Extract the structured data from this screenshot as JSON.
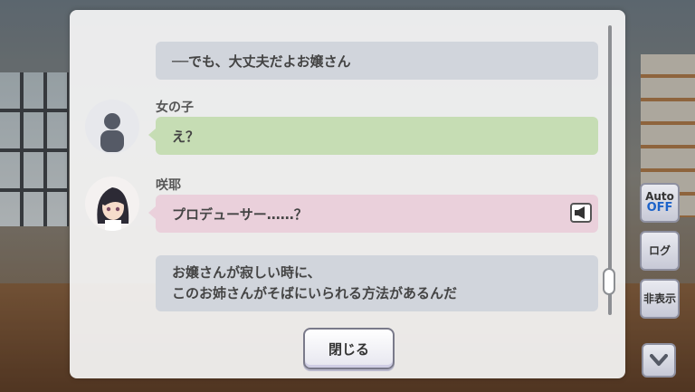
{
  "log": {
    "entries": [
      {
        "speaker": "",
        "text": "──でも、大丈夫だよお嬢さん"
      },
      {
        "speaker": "女の子",
        "text": "え？"
      },
      {
        "speaker": "咲耶",
        "text": "プロデューサー……？"
      },
      {
        "speaker": "",
        "text_line1": "お嬢さんが寂しい時に、",
        "text_line2": "このお姉さんがそばにいられる方法があるんだ"
      }
    ],
    "close_label": "閉じる"
  },
  "side_menu": {
    "auto_label": "Auto",
    "auto_state": "OFF",
    "log_label": "ログ",
    "hide_label": "非表示"
  },
  "icons": {
    "voice": "speaker-icon",
    "scroll_down": "chevron-down-icon",
    "unknown_avatar": "silhouette-icon"
  },
  "colors": {
    "narration_bubble": "#d1d5dc",
    "girl_bubble": "#c6ddb4",
    "sakuya_bubble": "#ead0db",
    "auto_off": "#1d63c9"
  }
}
